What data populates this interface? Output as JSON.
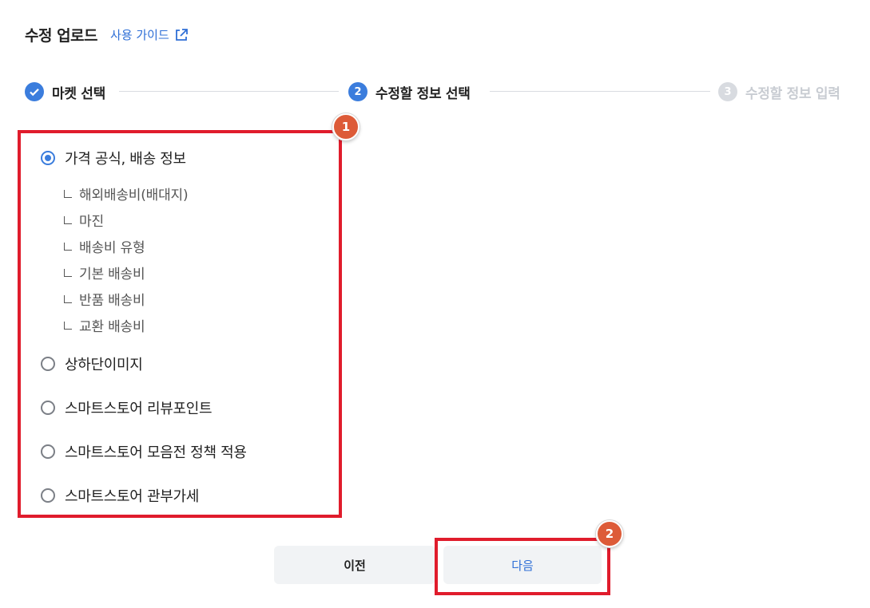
{
  "header": {
    "title": "수정 업로드",
    "guide_link": "사용 가이드"
  },
  "stepper": {
    "steps": [
      {
        "number": "✓",
        "label": "마켓 선택",
        "state": "completed"
      },
      {
        "number": "2",
        "label": "수정할 정보 선택",
        "state": "active"
      },
      {
        "number": "3",
        "label": "수정할 정보 입력",
        "state": "pending"
      }
    ]
  },
  "options": [
    {
      "label": "가격 공식, 배송 정보",
      "checked": true,
      "sub_items": [
        "해외배송비(배대지)",
        "마진",
        "배송비 유형",
        "기본 배송비",
        "반품 배송비",
        "교환 배송비"
      ]
    },
    {
      "label": "상하단이미지",
      "checked": false
    },
    {
      "label": "스마트스토어 리뷰포인트",
      "checked": false
    },
    {
      "label": "스마트스토어 모음전 정책 적용",
      "checked": false
    },
    {
      "label": "스마트스토어 관부가세",
      "checked": false
    }
  ],
  "annotations": {
    "badge1": "1",
    "badge2": "2"
  },
  "buttons": {
    "prev": "이전",
    "next": "다음"
  },
  "colors": {
    "accent": "#3b7ddd",
    "highlight": "#e01c2c",
    "badge": "#dd5b38"
  }
}
